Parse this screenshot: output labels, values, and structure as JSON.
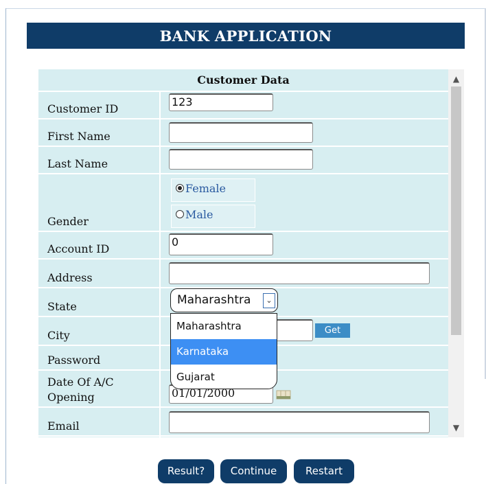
{
  "header": {
    "title": "BANK APPLICATION"
  },
  "form": {
    "section_title": "Customer Data",
    "fields": {
      "customer_id": {
        "label": "Customer ID",
        "value": "123"
      },
      "first_name": {
        "label": "First Name",
        "value": ""
      },
      "last_name": {
        "label": "Last Name",
        "value": ""
      },
      "gender": {
        "label": "Gender",
        "options": [
          "Female",
          "Male"
        ],
        "selected": "Female"
      },
      "account_id": {
        "label": "Account ID",
        "value": "0"
      },
      "address": {
        "label": "Address",
        "value": ""
      },
      "state": {
        "label": "State",
        "selected": "Maharashtra",
        "options": [
          "Maharashtra",
          "Karnataka",
          "Gujarat"
        ],
        "highlighted": "Karnataka"
      },
      "city": {
        "label": "City",
        "value": "",
        "get_button": "Get"
      },
      "password": {
        "label": "Password",
        "value": ""
      },
      "date_of_opening": {
        "label_line1": "Date Of A/C",
        "label_line2": "Opening",
        "value": "01/01/2000"
      },
      "email": {
        "label": "Email",
        "value": ""
      }
    }
  },
  "buttons": {
    "result": "Result?",
    "continue": "Continue",
    "restart": "Restart"
  },
  "colors": {
    "banner": "#0f3c68",
    "form_bg": "#d7eef1",
    "highlight": "#3d8ff3",
    "get_button": "#3c8dc6"
  },
  "icons": {
    "calendar": "calendar-icon",
    "scroll_up": "chevron-up-icon",
    "scroll_down": "chevron-down-icon",
    "dropdown": "chevron-down-icon"
  }
}
